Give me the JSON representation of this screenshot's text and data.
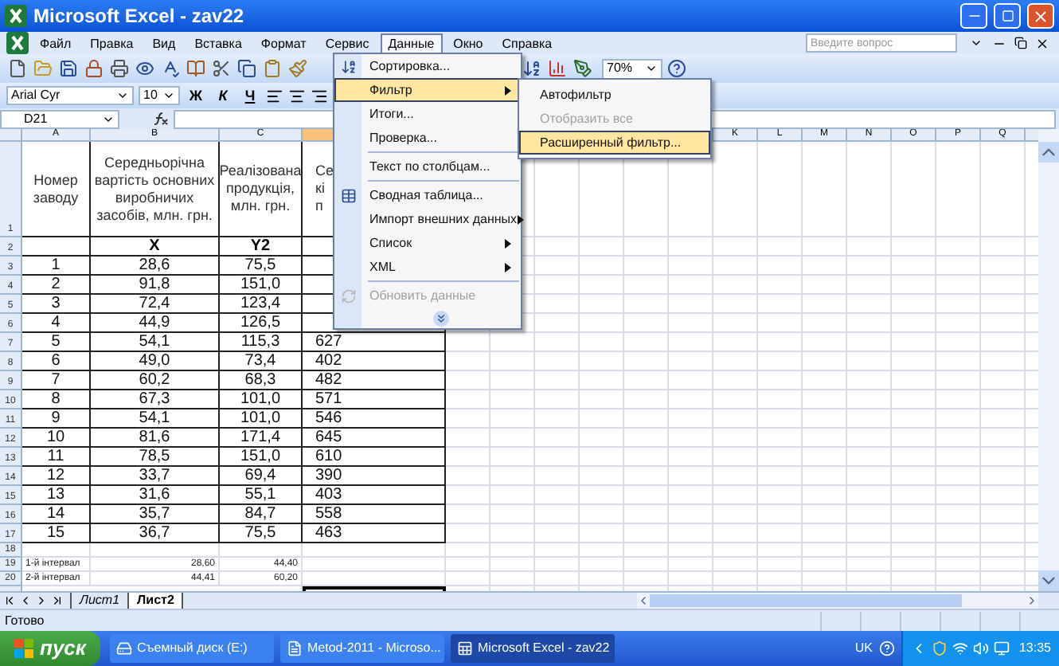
{
  "window": {
    "title": "Microsoft Excel - zav22"
  },
  "menu_bar": [
    {
      "label": "Файл",
      "selected": false
    },
    {
      "label": "Правка",
      "selected": false
    },
    {
      "label": "Вид",
      "selected": false
    },
    {
      "label": "Вставка",
      "selected": false
    },
    {
      "label": "Формат",
      "selected": false
    },
    {
      "label": "Сервис",
      "selected": false
    },
    {
      "label": "Данные",
      "selected": true
    },
    {
      "label": "Окно",
      "selected": false
    },
    {
      "label": "Справка",
      "selected": false
    }
  ],
  "help_search": {
    "placeholder": "Введите вопрос"
  },
  "standard_toolbar": {
    "zoom": "70%"
  },
  "format_toolbar": {
    "font": "Arial Cyr",
    "size": "10",
    "style_buttons": [
      {
        "label": "Ж",
        "kind": "bold"
      },
      {
        "label": "К",
        "kind": "italic"
      },
      {
        "label": "Ч",
        "kind": "underline"
      }
    ]
  },
  "formula_bar": {
    "name_box": "D21"
  },
  "column_headers": {
    "left": [
      "A",
      "B",
      "C"
    ],
    "right": [
      "K",
      "L",
      "M",
      "N",
      "O",
      "P",
      "Q"
    ]
  },
  "rows": [
    {
      "row": "1",
      "kind": "header",
      "a": "Номер заводу",
      "b": "Середньорічна вартість основних виробничих засобів, млн. грн.",
      "c": "Реалізована продукція, млн. грн.",
      "d": "Се кі п"
    },
    {
      "row": "2",
      "kind": "labels",
      "b": "X",
      "c": "Y2"
    },
    {
      "row": "3",
      "kind": "data",
      "a": "1",
      "b": "28,6",
      "c": "75,5"
    },
    {
      "row": "4",
      "kind": "data",
      "a": "2",
      "b": "91,8",
      "c": "151,0"
    },
    {
      "row": "5",
      "kind": "data",
      "a": "3",
      "b": "72,4",
      "c": "123,4"
    },
    {
      "row": "6",
      "kind": "data",
      "a": "4",
      "b": "44,9",
      "c": "126,5"
    },
    {
      "row": "7",
      "kind": "data",
      "a": "5",
      "b": "54,1",
      "c": "115,3",
      "d": "627"
    },
    {
      "row": "8",
      "kind": "data",
      "a": "6",
      "b": "49,0",
      "c": "73,4",
      "d": "402"
    },
    {
      "row": "9",
      "kind": "data",
      "a": "7",
      "b": "60,2",
      "c": "68,3",
      "d": "482"
    },
    {
      "row": "10",
      "kind": "data",
      "a": "8",
      "b": "67,3",
      "c": "101,0",
      "d": "571"
    },
    {
      "row": "11",
      "kind": "data",
      "a": "9",
      "b": "54,1",
      "c": "101,0",
      "d": "546"
    },
    {
      "row": "12",
      "kind": "data",
      "a": "10",
      "b": "81,6",
      "c": "171,4",
      "d": "645"
    },
    {
      "row": "13",
      "kind": "data",
      "a": "11",
      "b": "78,5",
      "c": "151,0",
      "d": "610"
    },
    {
      "row": "14",
      "kind": "data",
      "a": "12",
      "b": "33,7",
      "c": "69,4",
      "d": "390"
    },
    {
      "row": "15",
      "kind": "data",
      "a": "13",
      "b": "31,6",
      "c": "55,1",
      "d": "403"
    },
    {
      "row": "16",
      "kind": "data",
      "a": "14",
      "b": "35,7",
      "c": "84,7",
      "d": "558"
    },
    {
      "row": "17",
      "kind": "data",
      "a": "15",
      "b": "36,7",
      "c": "75,5",
      "d": "463"
    },
    {
      "row": "18",
      "kind": "blank"
    },
    {
      "row": "19",
      "kind": "interval",
      "a": "1-й інтервал",
      "b": "28,60",
      "c": "44,40"
    },
    {
      "row": "20",
      "kind": "interval",
      "a": "2-й інтервал",
      "b": "44,41",
      "c": "60,20"
    }
  ],
  "data_menu": [
    {
      "kind": "item",
      "label": "Сортировка...",
      "selected": false,
      "disabled": false,
      "submenu": false
    },
    {
      "kind": "item",
      "label": "Фильтр",
      "selected": true,
      "disabled": false,
      "submenu": true
    },
    {
      "kind": "item",
      "label": "Итоги...",
      "selected": false,
      "disabled": false,
      "submenu": false
    },
    {
      "kind": "item",
      "label": "Проверка...",
      "selected": false,
      "disabled": false,
      "submenu": false
    },
    {
      "kind": "separator"
    },
    {
      "kind": "item",
      "label": "Текст по столбцам...",
      "selected": false,
      "disabled": false,
      "submenu": false
    },
    {
      "kind": "separator"
    },
    {
      "kind": "item",
      "label": "Сводная таблица...",
      "selected": false,
      "disabled": false,
      "submenu": false
    },
    {
      "kind": "item",
      "label": "Импорт внешних данных",
      "selected": false,
      "disabled": false,
      "submenu": true
    },
    {
      "kind": "item",
      "label": "Список",
      "selected": false,
      "disabled": false,
      "submenu": true
    },
    {
      "kind": "item",
      "label": "XML",
      "selected": false,
      "disabled": false,
      "submenu": true
    },
    {
      "kind": "separator"
    },
    {
      "kind": "item",
      "label": "Обновить данные",
      "selected": false,
      "disabled": true,
      "submenu": false
    },
    {
      "kind": "expand"
    }
  ],
  "filter_submenu": [
    {
      "label": "Автофильтр",
      "selected": false,
      "disabled": false
    },
    {
      "label": "Отобразить все",
      "selected": false,
      "disabled": true
    },
    {
      "label": "Расширенный фильтр...",
      "selected": true,
      "disabled": false
    }
  ],
  "sheet_tabs": [
    {
      "label": "Лист1",
      "selected": false
    },
    {
      "label": "Лист2",
      "selected": true
    }
  ],
  "status_bar": {
    "text": "Готово"
  },
  "taskbar": {
    "start": "пуск",
    "tasks": [
      {
        "label": "Съемный диск (E:)",
        "selected": false
      },
      {
        "label": "Metod-2011 - Microso...",
        "selected": false
      },
      {
        "label": "Microsoft Excel - zav22",
        "selected": true
      }
    ],
    "language": "UK",
    "clock": "13:35"
  }
}
